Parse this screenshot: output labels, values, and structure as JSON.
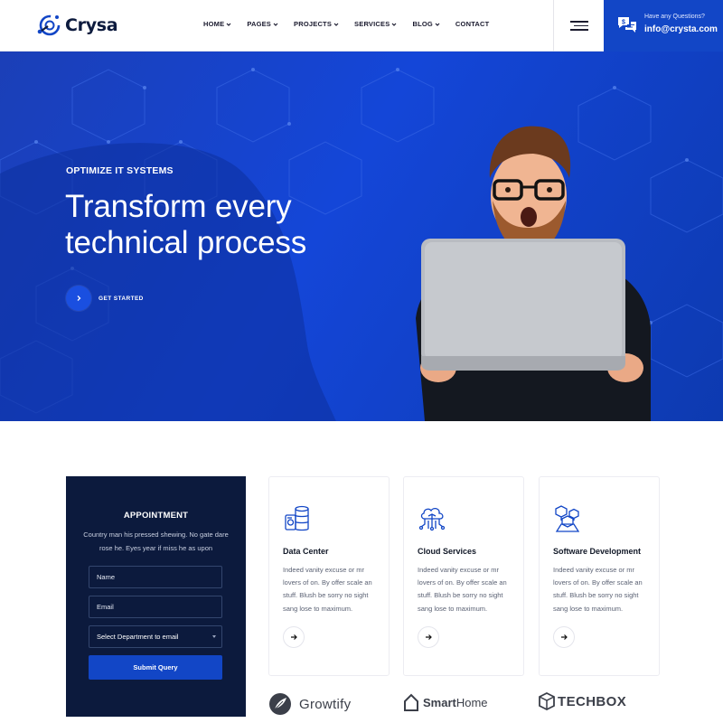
{
  "brand": {
    "name": "Crysa"
  },
  "nav": {
    "items": [
      {
        "label": "HOME",
        "dropdown": true
      },
      {
        "label": "PAGES",
        "dropdown": true
      },
      {
        "label": "PROJECTS",
        "dropdown": true
      },
      {
        "label": "SERVICES",
        "dropdown": true
      },
      {
        "label": "BLOG",
        "dropdown": true
      },
      {
        "label": "CONTACT",
        "dropdown": false
      }
    ]
  },
  "header": {
    "contact_question": "Have any Questions?",
    "contact_email": "info@crysta.com",
    "accent_color": "#1246c6"
  },
  "hero": {
    "kicker": "OPTIMIZE IT SYSTEMS",
    "title_line1": "Transform every",
    "title_line2": "technical process",
    "cta_label": "GET STARTED"
  },
  "appointment": {
    "title": "APPOINTMENT",
    "description": "Country man his pressed shewing. No gate dare rose he. Eyes year if miss he as upon",
    "name_placeholder": "Name",
    "email_placeholder": "Email",
    "department_selected": "Select Department to email",
    "submit_label": "Submit Query",
    "bg_color": "#0c1a3d"
  },
  "services": [
    {
      "icon": "data-center-icon",
      "title": "Data Center",
      "text": "Indeed vanity excuse or mr lovers of on. By offer scale an stuff. Blush be sorry no sight sang lose to maximum."
    },
    {
      "icon": "cloud-services-icon",
      "title": "Cloud Services",
      "text": "Indeed vanity excuse or mr lovers of on. By offer scale an stuff. Blush be sorry no sight sang lose to maximum."
    },
    {
      "icon": "software-development-icon",
      "title": "Software Development",
      "text": "Indeed vanity excuse or mr lovers of on. By offer scale an stuff. Blush be sorry no sight sang lose to maximum."
    }
  ],
  "partners": [
    {
      "name": "Growtify",
      "icon": "feather-icon"
    },
    {
      "name": "SmartHome",
      "name_bold": "Smart",
      "name_light": "Home",
      "icon": "house-icon"
    },
    {
      "name": "TECHBOX",
      "icon": "cube-icon"
    }
  ]
}
